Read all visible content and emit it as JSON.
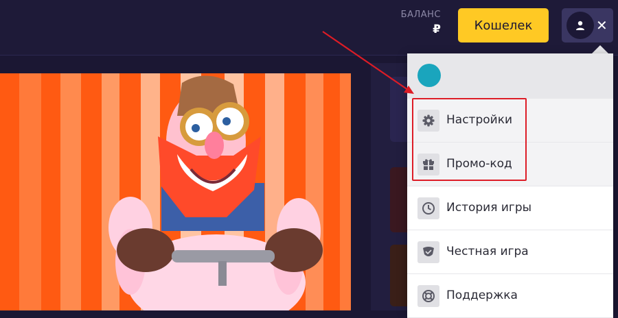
{
  "header": {
    "balance_label": "БАЛАНС",
    "balance_value": "₽",
    "wallet_button": "Кошелек",
    "close_symbol": "✕"
  },
  "menu": {
    "items": [
      {
        "label": "Настройки",
        "icon": "gear-icon"
      },
      {
        "label": "Промо-код",
        "icon": "gift-icon"
      },
      {
        "label": "История игры",
        "icon": "clock-icon"
      },
      {
        "label": "Честная игра",
        "icon": "shield-icon"
      },
      {
        "label": "Поддержка",
        "icon": "lifebuoy-icon"
      }
    ]
  },
  "colors": {
    "accent_yellow": "#ffc924",
    "header_bg": "#1e1a38",
    "highlight_red": "#dd1c26",
    "avatar_teal": "#1aa5bd",
    "game_orange": "#ff5a12"
  }
}
